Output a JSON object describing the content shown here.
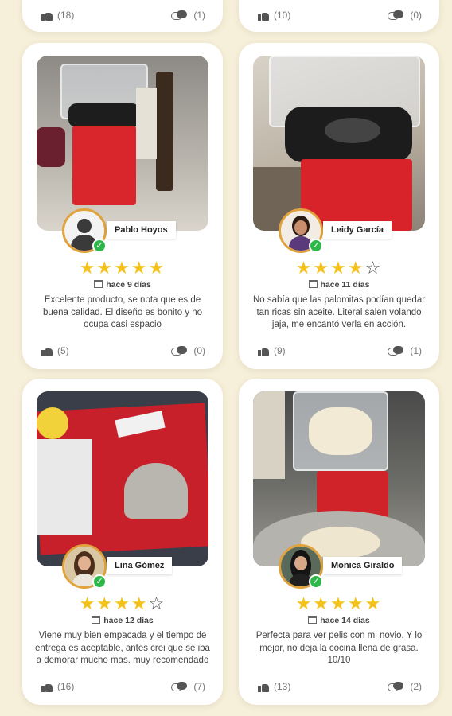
{
  "top_cards": [
    {
      "likes": "(18)",
      "comments": "(1)"
    },
    {
      "likes": "(10)",
      "comments": "(0)"
    }
  ],
  "reviews": [
    {
      "name": "Pablo Hoyos",
      "stars": 5,
      "date": "hace 9 días",
      "text": "Excelente producto, se nota que es de buena calidad. El diseño es bonito y no ocupa casi espacio",
      "likes": "(5)",
      "comments": "(0)"
    },
    {
      "name": "Leidy García",
      "stars": 4,
      "date": "hace 11 días",
      "text": "No sabía que las palomitas podían quedar tan ricas sin aceite. Literal salen volando jaja, me encantó verla en acción.",
      "likes": "(9)",
      "comments": "(1)"
    },
    {
      "name": "Lina Gómez",
      "stars": 4,
      "date": "hace 12 días",
      "text": "Viene muy bien empacada y el tiempo de entrega es aceptable, antes crei que se iba a demorar mucho mas. muy recomendado",
      "likes": "(16)",
      "comments": "(7)"
    },
    {
      "name": "Monica Giraldo",
      "stars": 5,
      "date": "hace 14 días",
      "text": "Perfecta para ver pelis con mi novio. Y lo mejor, no deja la cocina llena de grasa. 10/10",
      "likes": "(13)",
      "comments": "(2)"
    }
  ],
  "colors": {
    "background": "#f6efd9",
    "star": "#f5c21b",
    "avatar_border": "#e0a33c",
    "verified": "#2fb84a"
  },
  "icons": [
    "thumbs-up-icon",
    "comment-icon",
    "calendar-icon",
    "star-icon",
    "verified-check-icon"
  ]
}
